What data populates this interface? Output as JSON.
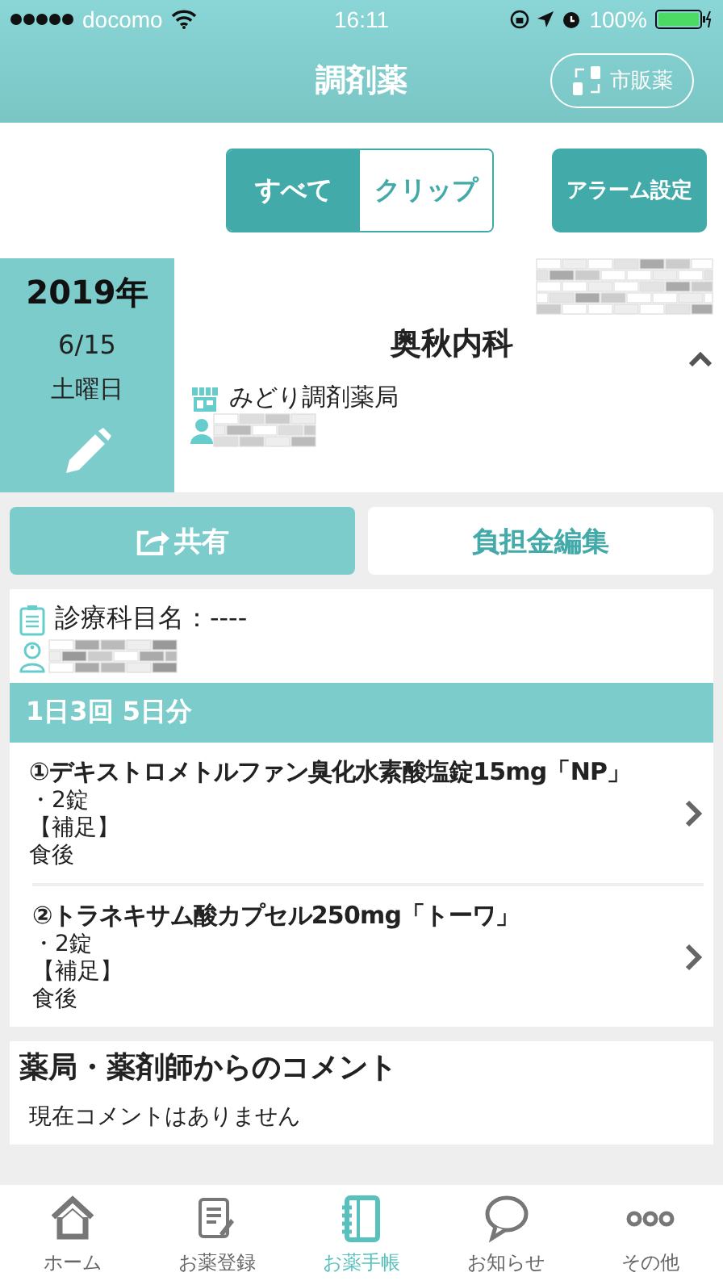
{
  "status_bar": {
    "carrier": "docomo",
    "time": "16:11",
    "battery": "100%"
  },
  "nav": {
    "title": "調剤薬",
    "otc_button": "市販薬"
  },
  "filter": {
    "segments": [
      {
        "label": "すべて",
        "selected": true
      },
      {
        "label": "クリップ",
        "selected": false
      }
    ],
    "alarm_button": "アラーム設定"
  },
  "record": {
    "year": "2019年",
    "date": "6/15",
    "weekday": "土曜日",
    "clinic": "奥秋内科",
    "pharmacy": "みどり調剤薬局",
    "expanded": true
  },
  "actions": {
    "share": "共有",
    "cost_edit": "負担金編集"
  },
  "department": "診療科目名：----",
  "dosage": {
    "schedule": "1日3回 5日分",
    "medicines": [
      {
        "name": "①デキストロメトルファン臭化水素酸塩錠15mg「NP」",
        "amount": "・2錠",
        "note_label": "【補足】",
        "note": "食後"
      },
      {
        "name": "②トラネキサム酸カプセル250mg「トーワ」",
        "amount": "・2錠",
        "note_label": "【補足】",
        "note": "食後"
      }
    ]
  },
  "comment": {
    "title": "薬局・薬剤師からのコメント",
    "text": "現在コメントはありません"
  },
  "tabs": [
    {
      "label": "ホーム",
      "kind": "home",
      "selected": false
    },
    {
      "label": "お薬登録",
      "kind": "register",
      "selected": false
    },
    {
      "label": "お薬手帳",
      "kind": "notebook",
      "selected": true
    },
    {
      "label": "お知らせ",
      "kind": "notice",
      "selected": false
    },
    {
      "label": "その他",
      "kind": "more",
      "selected": false
    }
  ]
}
